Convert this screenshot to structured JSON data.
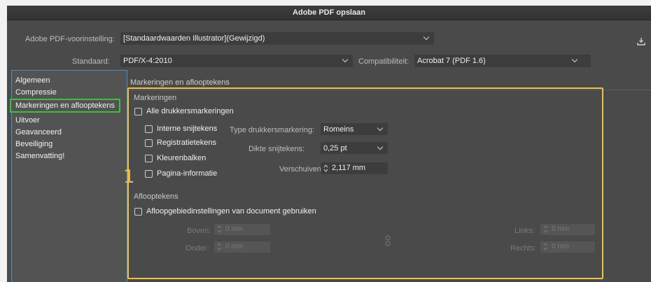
{
  "window": {
    "title": "Adobe PDF opslaan"
  },
  "header": {
    "preset_label": "Adobe PDF-voorinstelling:",
    "preset_value": "[Standaardwaarden Illustrator](Gewijzigd)",
    "standard_label": "Standaard:",
    "standard_value": "PDF/X-4:2010",
    "compat_label": "Compatibiliteit:",
    "compat_value": "Acrobat 7 (PDF 1.6)"
  },
  "sidebar": {
    "items": [
      {
        "label": "Algemeen"
      },
      {
        "label": "Compressie"
      },
      {
        "label": "Markeringen en aflooptekens"
      },
      {
        "label": "Uitvoer"
      },
      {
        "label": "Geavanceerd"
      },
      {
        "label": "Beveiliging"
      },
      {
        "label": "Samenvatting!"
      }
    ],
    "selected_index": 2
  },
  "annotations": {
    "number_marker": "1"
  },
  "panel": {
    "title": "Markeringen en aflooptekens",
    "markeringen": {
      "title": "Markeringen",
      "all_marks": "Alle drukkersmarkeringen",
      "checkboxes": [
        {
          "label": "Interne snijtekens"
        },
        {
          "label": "Registratietekens"
        },
        {
          "label": "Kleurenbalken"
        },
        {
          "label": "Pagina-informatie"
        }
      ],
      "mark_type_label": "Type drukkersmarkering:",
      "mark_type_value": "Romeins",
      "trim_weight_label": "Dikte snijtekens:",
      "trim_weight_value": "0,25 pt",
      "offset_label": "Verschuiven:",
      "offset_value": "2,117 mm"
    },
    "aflooptekens": {
      "title": "Aflooptekens",
      "use_doc": "Afloopgebiedinstellingen van document gebruiken",
      "top_label": "Boven:",
      "top_value": "0 mm",
      "bottom_label": "Onder:",
      "bottom_value": "0 mm",
      "left_label": "Links:",
      "left_value": "0 mm",
      "right_label": "Rechts:",
      "right_value": "0 mm"
    }
  },
  "colors": {
    "dialog_bg": "#4a4a4a",
    "highlight_yellow": "#f0c040",
    "highlight_green": "#3fbf3f",
    "sidebar_border": "#4a90c8"
  }
}
